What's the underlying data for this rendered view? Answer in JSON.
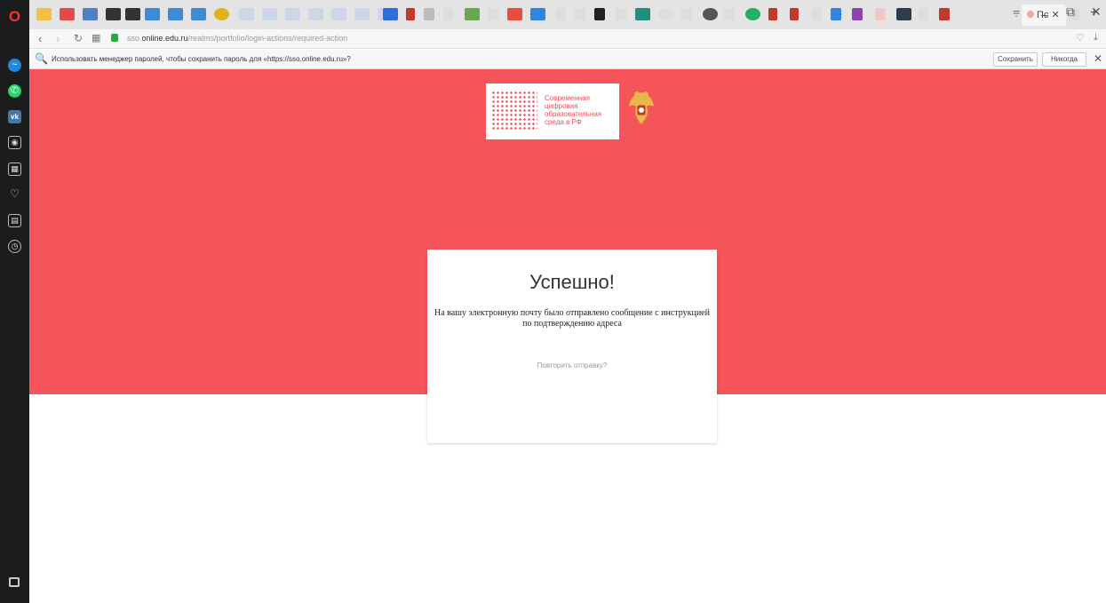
{
  "browser": {
    "sidebar_logo": "O",
    "address": {
      "url_prefix": "sso.",
      "url_domain": "online.edu.ru",
      "url_path": "/realms/portfolio/login-actions/required-action"
    },
    "active_tab": {
      "label": "Пс"
    }
  },
  "password_bar": {
    "message": "Использовать менеджер паролей, чтобы сохранить пароль для «https://sso.online.edu.ru»?",
    "save_label": "Сохранить",
    "never_label": "Никогда",
    "close": "✕"
  },
  "brand": {
    "lines": [
      "Современная",
      "цифровая",
      "образовательная",
      "среда в РФ"
    ]
  },
  "card": {
    "title": "Успешно!",
    "message_line1": "На вашу электронную почту было отправлено сообщение с инструкцией",
    "message_line2": "по подтверждению адреса",
    "resend_link": "Повторить отправку?"
  },
  "colors": {
    "accent": "#f4545a",
    "brand_text": "#e9535a"
  }
}
